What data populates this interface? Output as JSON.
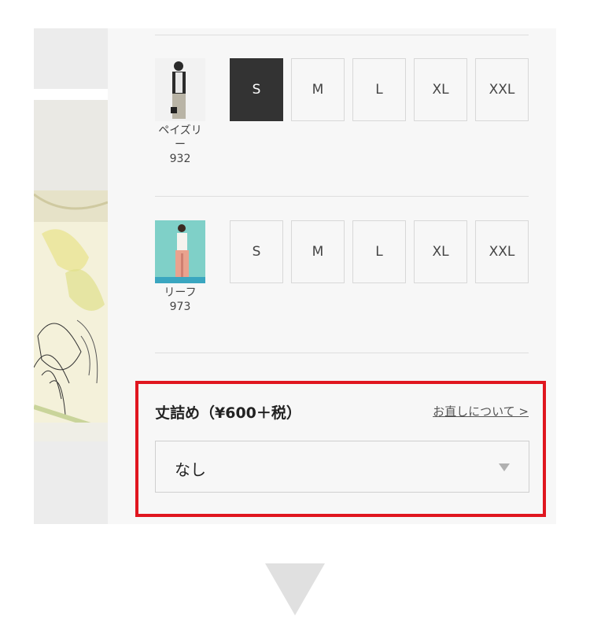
{
  "variants": [
    {
      "name": "ペイズリー",
      "code": "932",
      "sizes": [
        {
          "label": "S",
          "selected": true
        },
        {
          "label": "M",
          "selected": false
        },
        {
          "label": "L",
          "selected": false
        },
        {
          "label": "XL",
          "selected": false
        },
        {
          "label": "XXL",
          "selected": false
        }
      ]
    },
    {
      "name": "リーフ",
      "code": "973",
      "sizes": [
        {
          "label": "S",
          "selected": false
        },
        {
          "label": "M",
          "selected": false
        },
        {
          "label": "L",
          "selected": false
        },
        {
          "label": "XL",
          "selected": false
        },
        {
          "label": "XXL",
          "selected": false
        }
      ]
    }
  ],
  "alteration": {
    "title": "丈詰め（¥600＋税）",
    "link_label": "お直しについて >",
    "select_value": "なし"
  },
  "colors": {
    "highlight_border": "#e0161f",
    "selected_size_bg": "#333333",
    "panel_bg": "#f7f7f7"
  }
}
